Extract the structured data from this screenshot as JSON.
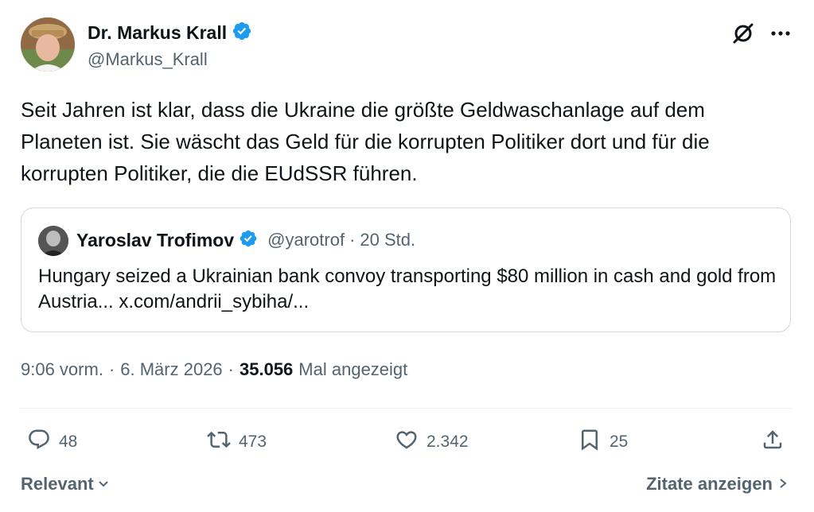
{
  "author": {
    "name": "Dr. Markus Krall",
    "handle": "@Markus_Krall"
  },
  "tweet": {
    "text": "Seit Jahren ist klar, dass die Ukraine die größte Geldwaschanlage auf dem Planeten ist. Sie wäscht das Geld für die korrupten Politiker dort und für die korrupten Politiker, die die EUdSSR führen."
  },
  "quote": {
    "name": "Yaroslav Trofimov",
    "handle": "@yarotrof",
    "separator": "·",
    "time": "20 Std.",
    "text": "Hungary seized a Ukrainian bank convoy transporting $80 million in cash and gold from Austria... x.com/andrii_sybiha/..."
  },
  "meta": {
    "time": "9:06 vorm.",
    "separator": "·",
    "date": "6. März 2026",
    "views": "35.056",
    "views_label": "Mal angezeigt"
  },
  "actions": {
    "replies": "48",
    "reposts": "473",
    "likes": "2.342",
    "bookmarks": "25"
  },
  "footer": {
    "sort_label": "Relevant",
    "quotes_label": "Zitate anzeigen"
  },
  "colors": {
    "text": "#0f1419",
    "secondary": "#536471",
    "verified": "#1d9bf0",
    "border": "#cfd9de"
  },
  "icons": [
    "verified-icon",
    "grok-icon",
    "more-icon",
    "reply-icon",
    "repost-icon",
    "like-icon",
    "bookmark-icon",
    "share-icon",
    "chevron-down-icon",
    "chevron-right-icon"
  ]
}
